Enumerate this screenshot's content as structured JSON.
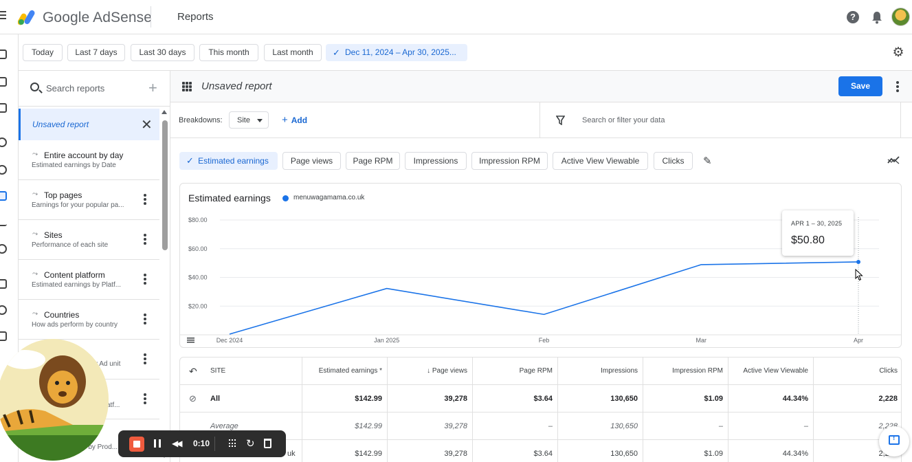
{
  "app": {
    "brand": "Google AdSense",
    "page_title": "Reports",
    "help_symbol": "?"
  },
  "date_range": {
    "chips": [
      "Today",
      "Last 7 days",
      "Last 30 days",
      "This month",
      "Last month"
    ],
    "selected": "Dec 11, 2024 – Apr 30, 2025..."
  },
  "sidebar": {
    "search_placeholder": "Search reports",
    "active_report": "Unsaved report",
    "reports": [
      {
        "title": "Entire account by day",
        "subtitle": "Estimated earnings by Date"
      },
      {
        "title": "Top pages",
        "subtitle": "Earnings for your popular pa..."
      },
      {
        "title": "Sites",
        "subtitle": "Performance of each site"
      },
      {
        "title": "Content platform",
        "subtitle": "Estimated earnings by Platf..."
      },
      {
        "title": "Countries",
        "subtitle": "How ads perform by country"
      },
      {
        "title": "",
        "subtitle": "y Ad unit"
      },
      {
        "title": "",
        "subtitle": "atf..."
      },
      {
        "title": "",
        "subtitle": "gs by Prod..."
      }
    ]
  },
  "report": {
    "name": "Unsaved report",
    "save_label": "Save"
  },
  "breakdowns": {
    "label": "Breakdowns:",
    "selected": "Site",
    "add_label": "Add",
    "filter_placeholder": "Search or filter your data"
  },
  "metrics": {
    "chips": [
      "Estimated earnings",
      "Page views",
      "Page RPM",
      "Impressions",
      "Impression RPM",
      "Active View Viewable",
      "Clicks"
    ],
    "active": "Estimated earnings"
  },
  "chart_data": {
    "type": "line",
    "title": "Estimated earnings",
    "series": [
      {
        "name": "menuwagamama.co.uk",
        "color": "#1a73e8",
        "values": [
          0.5,
          32.3,
          14.2,
          48.9,
          50.8
        ]
      }
    ],
    "categories": [
      "Dec 2024",
      "Jan 2025",
      "Feb",
      "Mar",
      "Apr"
    ],
    "y_ticks": [
      "$20.00",
      "$40.00",
      "$60.00",
      "$80.00"
    ],
    "y_tick_values": [
      20,
      40,
      60,
      80
    ],
    "ylim": [
      0,
      80
    ],
    "grid": true,
    "legend_placement": "top-left",
    "tooltip": {
      "label": "APR 1 – 30, 2025",
      "value": "$50.80"
    }
  },
  "table": {
    "headers": [
      "SITE",
      "Estimated earnings *",
      "↓ Page views",
      "Page RPM",
      "Impressions",
      "Impression RPM",
      "Active View Viewable",
      "Clicks"
    ],
    "rows": [
      {
        "kind": "total",
        "cells": [
          "All",
          "$142.99",
          "39,278",
          "$3.64",
          "130,650",
          "$1.09",
          "44.34%",
          "2,228"
        ]
      },
      {
        "kind": "avg",
        "cells": [
          "Average",
          "$142.99",
          "39,278",
          "–",
          "130,650",
          "–",
          "–",
          "2,228"
        ]
      },
      {
        "kind": "row1",
        "cells": [
          "uk",
          "$142.99",
          "39,278",
          "$3.64",
          "130,650",
          "$1.09",
          "44.34%",
          "2,228"
        ]
      }
    ]
  },
  "recorder": {
    "time": "0:10"
  },
  "colors": {
    "accent": "#1a73e8",
    "record": "#ef5b3e"
  }
}
